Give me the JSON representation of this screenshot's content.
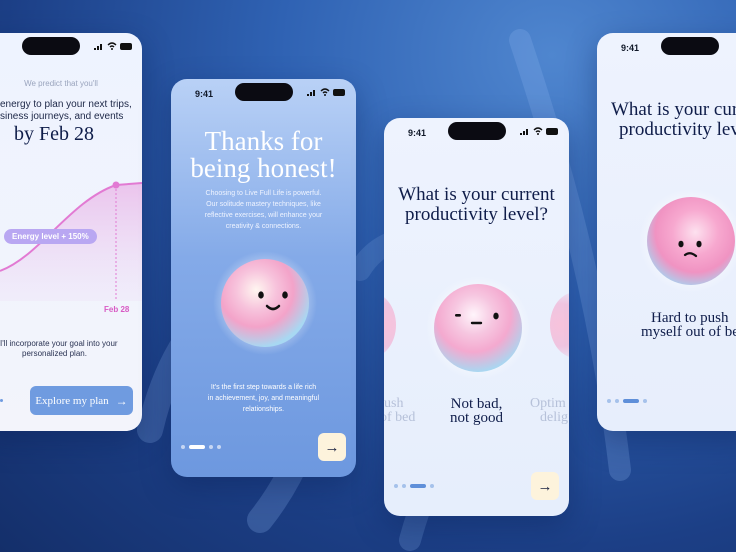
{
  "colors": {
    "background": "#1f4a99",
    "accent_pink": "#e77ad6",
    "button_blue": "#6f9be0",
    "arrow_button_bg": "#fdf3dc",
    "text_navy": "#0f1d4a"
  },
  "screen1": {
    "predict_line": "We predict that you'll",
    "body_line1": "energy to plan your next trips,",
    "body_line2": "siness journeys, and events",
    "date_headline": "by Feb 28",
    "energy_badge": "Energy level + 150%",
    "axis_label": "Feb 28",
    "incorporate_line1": "I'll incorporate your goal into your",
    "incorporate_line2": "personalized plan.",
    "explore_button": "Explore my plan",
    "explore_arrow": "→"
  },
  "screen2": {
    "time": "9:41",
    "title_line1": "Thanks for",
    "title_line2": "being honest!",
    "desc_line1": "Choosing to Live Full Life is powerful.",
    "desc_line2": "Our solitude mastery techniques, like",
    "desc_line3": "reflective exercises, will enhance your",
    "desc_line4": "creativity & connections.",
    "foot_line1": "It's the first step towards a life rich",
    "foot_line2": "in achievement, joy, and meaningful",
    "foot_line3": "relationships.",
    "next_arrow": "→"
  },
  "screen3": {
    "time": "9:41",
    "title_line1": "What is your current",
    "title_line2": "productivity level?",
    "left_opt_line1": "ush",
    "left_opt_line2": "of bed",
    "center_opt_line1": "Not bad,",
    "center_opt_line2": "not good",
    "right_opt_line1": "Optim",
    "right_opt_line2": "delig",
    "next_arrow": "→"
  },
  "screen4": {
    "time": "9:41",
    "title_line1": "What is your cur",
    "title_line2": "productivity lev",
    "option_line1": "Hard to push",
    "option_line2": "myself out of bed"
  }
}
